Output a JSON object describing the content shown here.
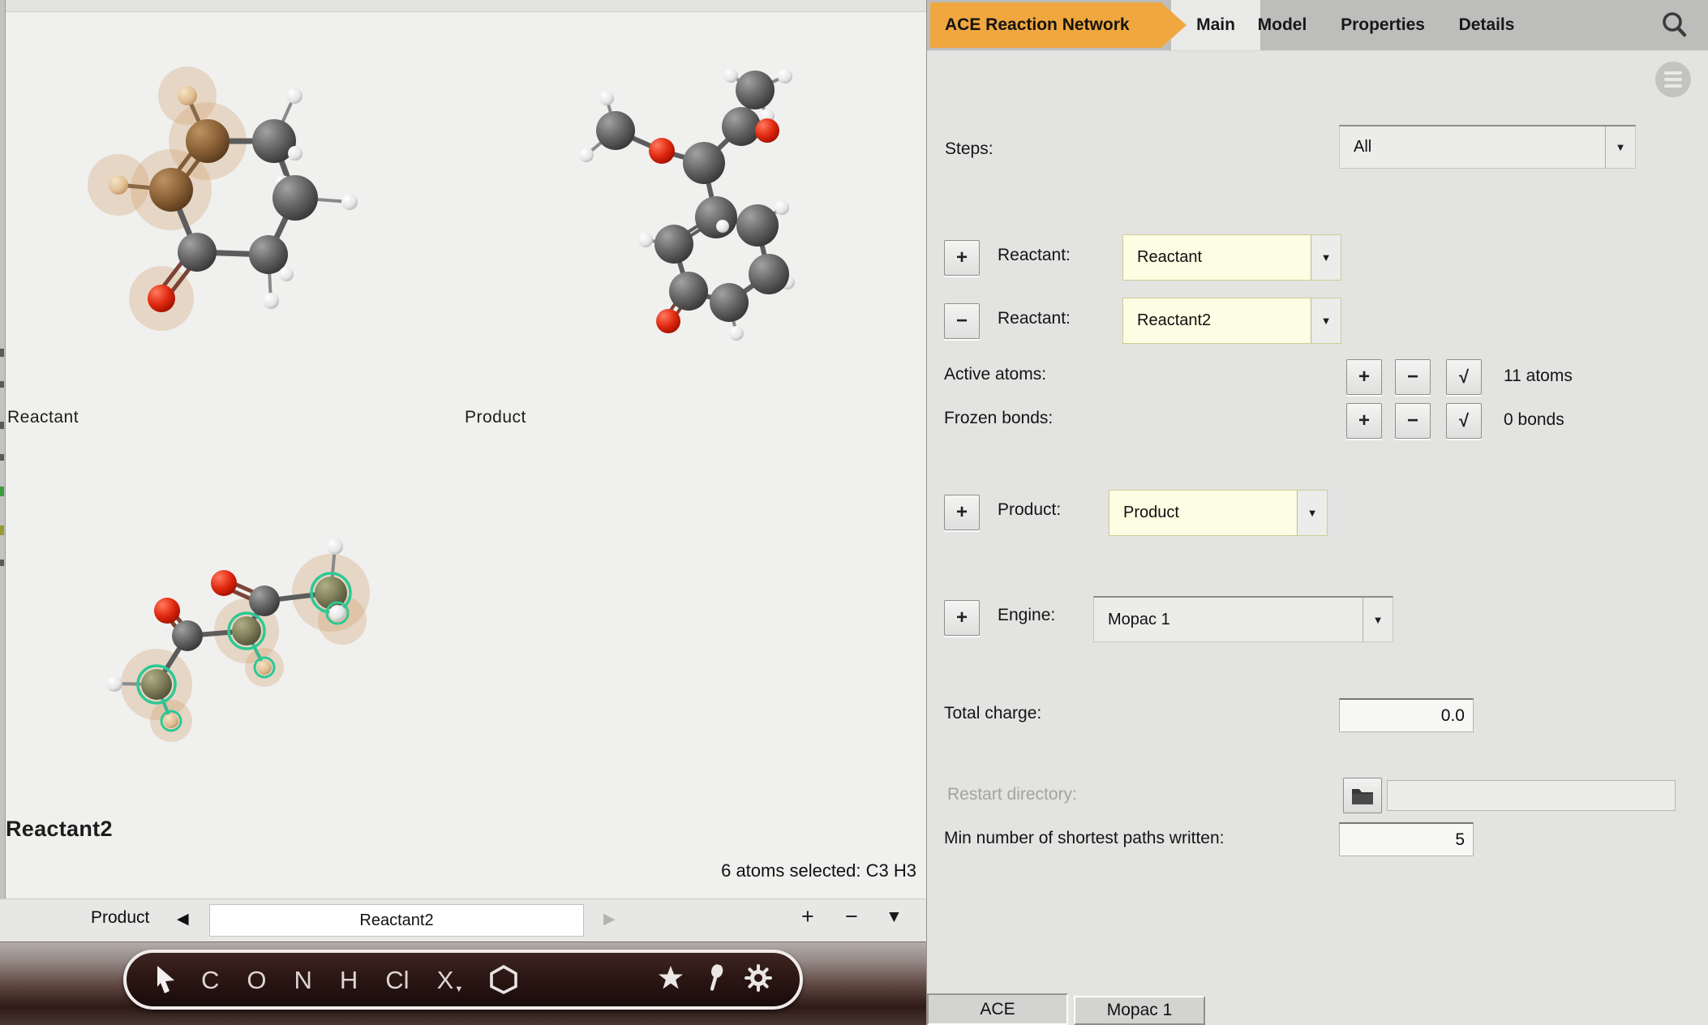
{
  "header": {
    "app_tab": "ACE Reaction Network",
    "tabs": [
      "Main",
      "Model",
      "Properties",
      "Details"
    ]
  },
  "panel": {
    "steps": {
      "label": "Steps:",
      "value": "All"
    },
    "reactant_add": {
      "symbol": "+",
      "label": "Reactant:",
      "value": "Reactant"
    },
    "reactant_remove": {
      "symbol": "−",
      "label": "Reactant:",
      "value": "Reactant2"
    },
    "active_atoms": {
      "label": "Active atoms:",
      "plus": "+",
      "minus": "−",
      "check": "√",
      "count": "11 atoms"
    },
    "frozen_bonds": {
      "label": "Frozen bonds:",
      "plus": "+",
      "minus": "−",
      "check": "√",
      "count": "0 bonds"
    },
    "product": {
      "symbol": "+",
      "label": "Product:",
      "value": "Product"
    },
    "engine": {
      "symbol": "+",
      "label": "Engine:",
      "value": "Mopac 1"
    },
    "total_charge": {
      "label": "Total charge:",
      "value": "0.0"
    },
    "restart_directory": {
      "label": "Restart directory:",
      "value": ""
    },
    "min_paths": {
      "label": "Min number of shortest paths written:",
      "value": "5"
    },
    "bottom_tabs": [
      "ACE",
      "Mopac 1"
    ]
  },
  "viewport": {
    "labels": {
      "reactant": "Reactant",
      "product": "Product",
      "reactant2": "Reactant2"
    },
    "status": "6 atoms selected: C3 H3"
  },
  "navbar": {
    "prev_label": "Product",
    "prev_arrow": "◀",
    "current": "Reactant2",
    "next_arrow": "▶",
    "zoom_in": "+",
    "zoom_out": "−",
    "menu_arrow": "▼"
  },
  "toolbar": {
    "elements": [
      "C",
      "O",
      "N",
      "H",
      "Cl",
      "X"
    ],
    "x_caret": "▼"
  },
  "symbols": {
    "dropdown_arrow": "▼"
  },
  "colors": {
    "accent_orange": "#f0a73f",
    "selection_halo": "#d2a06a",
    "selection_ring": "#2ec894",
    "field_yellow": "#fdfde3"
  }
}
